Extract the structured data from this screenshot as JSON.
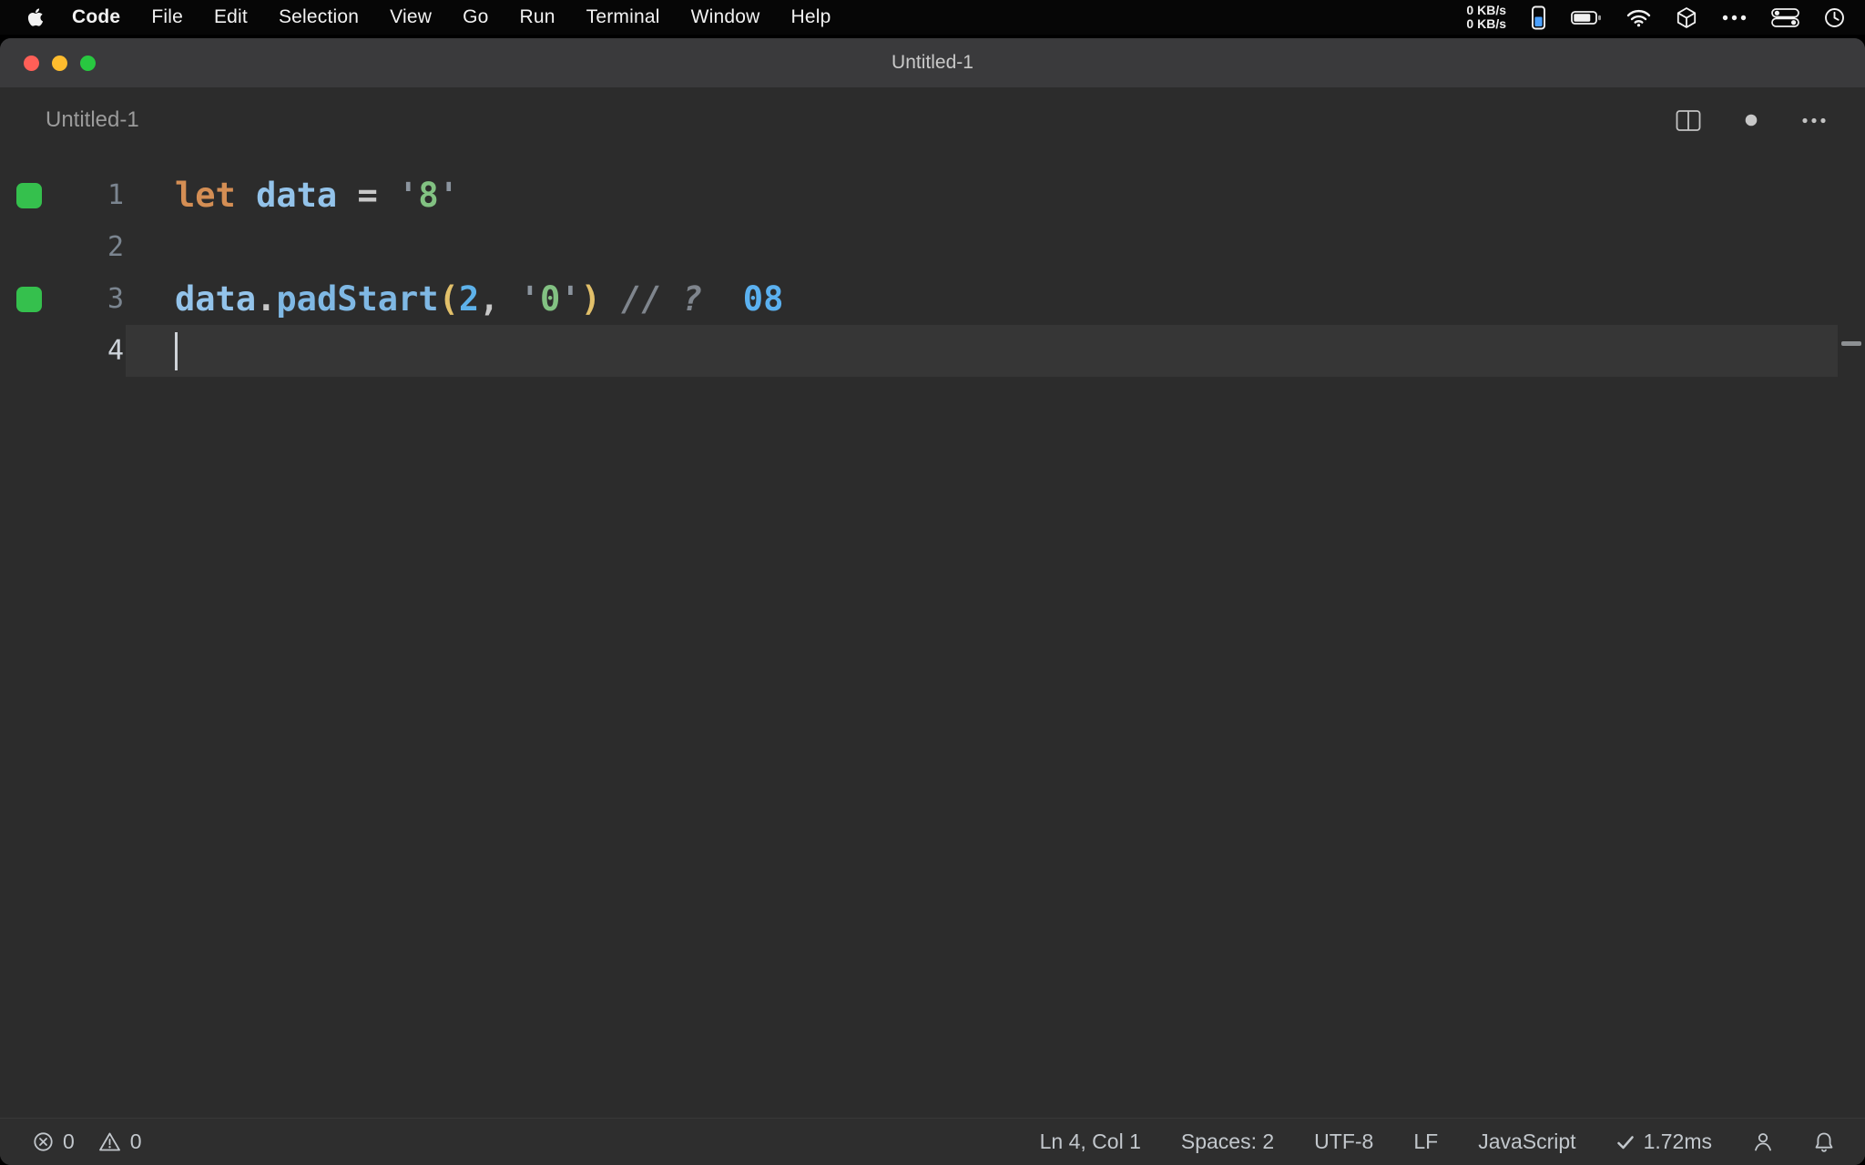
{
  "menu_bar": {
    "app_menu": "Code",
    "items": [
      "File",
      "Edit",
      "Selection",
      "View",
      "Go",
      "Run",
      "Terminal",
      "Window",
      "Help"
    ],
    "network_up": "0 KB/s",
    "network_down": "0 KB/s"
  },
  "titlebar": {
    "title": "Untitled-1"
  },
  "editor_header": {
    "tab_label": "Untitled-1"
  },
  "editor": {
    "line_numbers": [
      "1",
      "2",
      "3",
      "4"
    ],
    "code": {
      "line1": {
        "keyword": "let ",
        "variable": "data ",
        "operator": "= ",
        "quote_open": "'",
        "string": "8",
        "quote_close": "'"
      },
      "line3": {
        "object": "data",
        "dot": ".",
        "method": "padStart",
        "paren_open": "(",
        "number": "2",
        "comma": ", ",
        "quote_open": "'",
        "string": "0",
        "quote_close": "'",
        "paren_close": ")",
        "comment": " // ?",
        "result": "  08"
      }
    }
  },
  "status_bar": {
    "errors": "0",
    "warnings": "0",
    "cursor_position": "Ln 4, Col 1",
    "indentation": "Spaces: 2",
    "encoding": "UTF-8",
    "eol": "LF",
    "language": "JavaScript",
    "timing": "1.72ms"
  },
  "colors": {
    "keyword": "#d48e54",
    "variable": "#93c3ea",
    "method": "#7fb8e4",
    "string": "#82c182",
    "quote": "#8b949e",
    "number": "#5eb2ea",
    "paren": "#e2c06a",
    "comment": "#7f858d",
    "result": "#5bb1f0",
    "coverage_marker": "#35c04d",
    "traffic_red": "#ff5f57",
    "traffic_yellow": "#febc2e",
    "traffic_green": "#28c840"
  }
}
